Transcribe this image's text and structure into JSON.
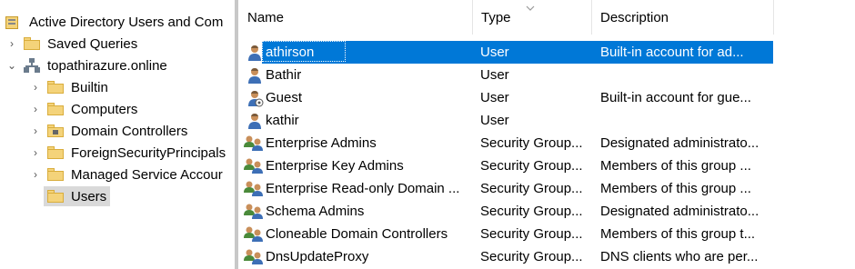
{
  "tree": {
    "root_label": "Active Directory Users and Com",
    "items": [
      {
        "label": "Saved Queries",
        "expander": "›"
      },
      {
        "label": "topathirazure.online",
        "expander": "⌄"
      },
      {
        "label": "Builtin",
        "expander": "›"
      },
      {
        "label": "Computers",
        "expander": "›"
      },
      {
        "label": "Domain Controllers",
        "expander": "›"
      },
      {
        "label": "ForeignSecurityPrincipals",
        "expander": "›"
      },
      {
        "label": "Managed Service Accour",
        "expander": "›"
      },
      {
        "label": "Users",
        "expander": ""
      }
    ]
  },
  "columns": {
    "name": "Name",
    "type": "Type",
    "description": "Description"
  },
  "rows": [
    {
      "name": "athirson",
      "type": "User",
      "description": "Built-in account for ad...",
      "icon": "user-icon"
    },
    {
      "name": "Bathir",
      "type": "User",
      "description": "",
      "icon": "user-icon"
    },
    {
      "name": "Guest",
      "type": "User",
      "description": "Built-in account for gue...",
      "icon": "guest-user-icon"
    },
    {
      "name": "kathir",
      "type": "User",
      "description": "",
      "icon": "user-icon"
    },
    {
      "name": "Enterprise Admins",
      "type": "Security Group...",
      "description": "Designated administrato...",
      "icon": "group-icon"
    },
    {
      "name": "Enterprise Key Admins",
      "type": "Security Group...",
      "description": "Members of this group ...",
      "icon": "group-icon"
    },
    {
      "name": "Enterprise Read-only Domain ...",
      "type": "Security Group...",
      "description": "Members of this group ...",
      "icon": "group-icon"
    },
    {
      "name": "Schema Admins",
      "type": "Security Group...",
      "description": "Designated administrato...",
      "icon": "group-icon"
    },
    {
      "name": "Cloneable Domain Controllers",
      "type": "Security Group...",
      "description": "Members of this group t...",
      "icon": "group-icon"
    },
    {
      "name": "DnsUpdateProxy",
      "type": "Security Group...",
      "description": "DNS clients who are per...",
      "icon": "group-icon"
    }
  ],
  "colors": {
    "selection": "#0078d7",
    "tree_selection": "#d9d9d9",
    "folder": "#f4d37a"
  }
}
